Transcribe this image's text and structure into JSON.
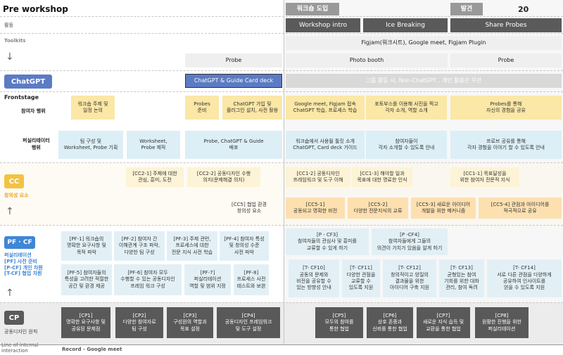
{
  "header": {
    "title": "Pre workshop",
    "phase1": "워크숍 도입",
    "phase2": "발견",
    "page_number": "20"
  },
  "rows": {
    "activity_label": "활동",
    "toolkits_label": "Toolkits",
    "chatgpt_label": "ChatGPT",
    "frontstage_label": "Frontstage",
    "participant_label": "참여자 행위",
    "facilitator_label": "퍼실리테이터\n행위",
    "cc_label": "CC",
    "cc_sub": "창의성 요소",
    "pf_label": "PF · CF",
    "pf_sub": "퍼실리테이션\n[PF] 사전 준비\n[P-CF] 개인 차원\n[T-CF] 협업 차원",
    "cp_label": "CP",
    "cp_sub": "공동디자인 원칙",
    "line_internal": "Line of internal\ninteraction",
    "record": "Record - Google meet"
  },
  "activities": [
    "Workshop intro",
    "Ice Breaking",
    "Share  Probes"
  ],
  "toolkits": {
    "figjam": "Figjam(워크시트), Google meet, Figjam Plugin",
    "probe1": "Probe",
    "photo_booth": "Photo booth",
    "probe2": "Probe"
  },
  "chatgpt": {
    "guide": "ChatGPT & Guide Card deck",
    "usage": "그룹 활동 시, Non-ChatGPT , 개인 활용은 무관"
  },
  "participant": [
    "워크숍 주제 및\n일정 논의",
    "Probes\n준비",
    "ChatGPT 가입 및\n플러그인 설치, 사전 활용",
    "Google meet, Figjam 접속\nChatGPT 학습, 프로세스 학습",
    "포토부스를 이용해 사진을 찍고\n각자 소개, 역할 소개",
    "Probes를 통해\n자신의 경험을 공유"
  ],
  "facilitator": [
    "팀 구성 및\nWorksheet, Probe 기획",
    "Worksheet,\nProbe 제작",
    "Probe, ChatGPT & Guide\n배포",
    "워크숍에서 사용될 툴킷 소개\nChatGPT, Card deck 가이드",
    "참여자들이\n각자 소개할 수 있도록 안내",
    "프로브 공유를 통해\n각자 경험을 이야기 할 수 있도록 안내"
  ],
  "cc": {
    "cc2_1": "[CC2-1] 주제에 대한\n관심, 흥미, 도전",
    "cc2_2": "[CC2-2] 공동디자인 수행\n의지(문제해결 의지)",
    "cc1_2": "[CC1-2] 공동디자인\n프레임워크 및 도구 이해",
    "cc1_3": "[CC1-3] 해야할 일과\n목표에 대한 명료한 인식",
    "cc1_1": "[CC1-1] 목표달성을\n위한 참여자 전문적 지식",
    "cc5_pre": "[CC5] 협업 환경\n창의성 요소",
    "cc5_1": "[CC5-1]\n공동되고 명확한 비전",
    "cc5_2": "[CC5-2]\n다양한 전문지식의 교류",
    "cc5_3": "[CC5-3] 새로운 아이디어\n개발을 위한 메커니즘",
    "cc5_4": "[CC5-4] 관점과 아이디어를\n적극적으로 공유"
  },
  "pf": [
    "[PF-1] 워크숍의\n명확한 요구사항 및\n목적 파악",
    "[PF-2] 참여자 간\n이해관계 구조 파악,\n다양한 팀 구성",
    "[PF-3] 주제 관련,\n프로세스에 대한\n전문 지식 사전 학습",
    "[PF-4] 참여자 특성\n및 창의성 수준\n사전 파악",
    "[PF-5] 참여자들의\n특성을 고려한 적절한\n공간 및 환경 제공",
    "[PF-6] 참여자 모두\n수행할 수 있는 공동디자인\n프레임 워크 구성",
    "[PF-7]\n퍼실리테이션\n역할 및 범위 지정",
    "[PF-8]\n프로세스 사전\n테스트와 보완"
  ],
  "pcf": [
    "[P - CF3]\n참여자들의 관심사 및 흥미를\n교류할 수 있게 하기",
    "[P -CF4]\n참여자들에게 그들의\n의견이 가치가 있음을 알게 하기"
  ],
  "tcf": [
    "[T- CF10]\n공동의 문제와\n비전을 공유할 수\n있는 방향성 안내",
    "[T- CF11]\n다양한 관점을\n교류할 수\n있도록 지원",
    "[T- CF12]\n창의적이고 양질의\n결과물을 위한\n아이디어 구축 지원",
    "[T- CF13]\n균형있는 참여\n기회를 위한 대화\n관리, 참여 독려",
    "[T- CF14]\n서로 다른 관점을 다양하게\n공유하여 인사이트를\n얻을 수 있도록 지원"
  ],
  "cp": [
    "[CP1]\n명확한 요구사항 및\n공유된 문제점",
    "[CP2]\n다양한 참여자로\n팀 구성",
    "[CP3]\n구성원의 역할과\n목표 설정",
    "[CP4]\n공동디자인 프레임워크\n및 도구 설정",
    "[CP5]\n모두의 참여를\n통한 협업",
    "[CP6]\n상호 존중과\n신뢰를 통한 협업",
    "[CP7]\n새로운 지식 습득 및\n교환을 통한 협업",
    "[CP8]\n원활한 진행을 위한\n퍼실리테이션"
  ],
  "colors": {
    "chatgpt_blue": "#5b7bc4",
    "cc_yellow": "#f3c244",
    "pf_blue": "#3f86d6",
    "cp_dark": "#5a5a5a"
  }
}
